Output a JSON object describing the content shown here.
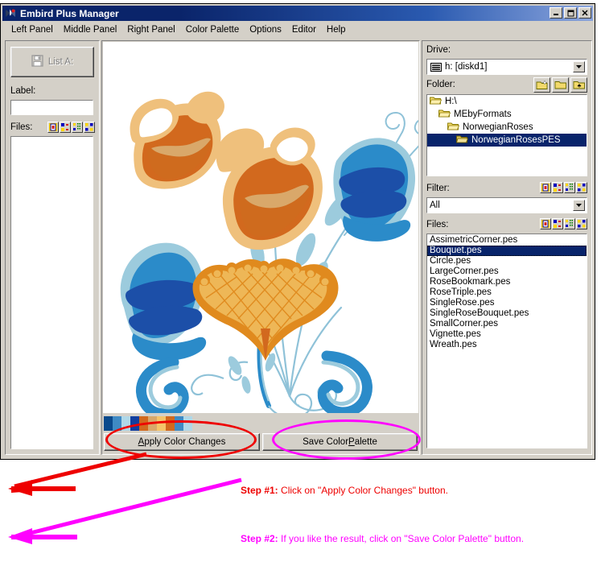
{
  "window": {
    "title": "Embird Plus Manager",
    "title_icon": "butterfly-icon",
    "controls": {
      "minimize": "_",
      "maximize": "□",
      "close": "✕"
    }
  },
  "menubar": {
    "items": [
      {
        "label": "Left Panel"
      },
      {
        "label": "Middle Panel"
      },
      {
        "label": "Right Panel"
      },
      {
        "label": "Color Palette"
      },
      {
        "label": "Options"
      },
      {
        "label": "Editor"
      },
      {
        "label": "Help"
      }
    ]
  },
  "left_panel": {
    "list_button": {
      "label": "List A:",
      "icon": "floppy-disk-icon",
      "disabled": true
    },
    "label_caption": "Label:",
    "label_value": "",
    "label_placeholder": "",
    "files_caption": "Files:",
    "view_buttons": [
      "large-icons-view",
      "small-icons-view",
      "list-view",
      "details-view"
    ],
    "file_items": []
  },
  "center_panel": {
    "design_name": "Bouquet.pes",
    "palette": {
      "colors": [
        "#0b4a8c",
        "#3f8ac4",
        "#b0d8e8",
        "#123fa0",
        "#d2691e",
        "#d9a86a",
        "#f5c469",
        "#d2691e",
        "#3f8ac4",
        "#b0d8e8"
      ]
    },
    "buttons": {
      "apply": {
        "pre": "A",
        "post": "pply Color Changes",
        "full": "Apply Color Changes"
      },
      "save": {
        "pre": "Save Color ",
        "mid": "P",
        "post": "alette",
        "full": "Save Color Palette"
      }
    }
  },
  "right_panel": {
    "drive_label": "Drive:",
    "drive_value": "h: [diskd1]",
    "drive_icon": "drive-icon",
    "folder_label": "Folder:",
    "folder_buttons": [
      "new-folder-icon",
      "open-folder-icon",
      "up-folder-icon"
    ],
    "folder_tree": [
      {
        "label": "H:\\",
        "level": 1,
        "selected": false
      },
      {
        "label": "MEbyFormats",
        "level": 2,
        "selected": false
      },
      {
        "label": "NorwegianRoses",
        "level": 3,
        "selected": false
      },
      {
        "label": "NorwegianRosesPES",
        "level": 4,
        "selected": true
      }
    ],
    "filter_label": "Filter:",
    "filter_value": "All",
    "filter_view_buttons": [
      "large-icons-view",
      "small-icons-view",
      "list-view",
      "details-view"
    ],
    "files_label": "Files:",
    "files_view_buttons": [
      "large-icons-view",
      "small-icons-view",
      "list-view",
      "details-view"
    ],
    "files": [
      {
        "name": "AssimetricCorner.pes",
        "selected": false
      },
      {
        "name": "Bouquet.pes",
        "selected": true
      },
      {
        "name": "Circle.pes",
        "selected": false
      },
      {
        "name": "LargeCorner.pes",
        "selected": false
      },
      {
        "name": "RoseBookmark.pes",
        "selected": false
      },
      {
        "name": "RoseTriple.pes",
        "selected": false
      },
      {
        "name": "SingleRose.pes",
        "selected": false
      },
      {
        "name": "SingleRoseBouquet.pes",
        "selected": false
      },
      {
        "name": "SmallCorner.pes",
        "selected": false
      },
      {
        "name": "Vignette.pes",
        "selected": false
      },
      {
        "name": "Wreath.pes",
        "selected": false
      }
    ]
  },
  "annotations": {
    "step1": {
      "bold": "Step #1:",
      "text": " Click on \"Apply Color Changes\" button.",
      "color": "#ee0000"
    },
    "step2": {
      "bold": "Step #2:",
      "text": " If you like the result, click on \"Save Color Palette\" button.",
      "color": "#ff00ff"
    }
  }
}
